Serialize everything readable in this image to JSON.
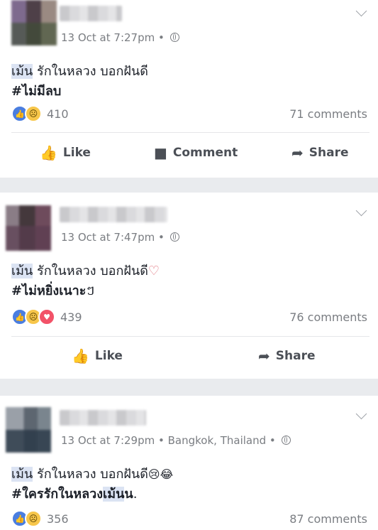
{
  "posts": [
    {
      "timestamp": "13 Oct at 7:27pm",
      "separator": "•",
      "line1_highlight": "เม้น",
      "line1_rest": " รักในหลวง บอกฝันดี",
      "line1_emoji": "",
      "line2_tag": "#ไม่มีลบ",
      "line2_highlight": "",
      "line2_tail": "",
      "reaction_count": "410",
      "comments": "71 comments",
      "actions": {
        "like": "Like",
        "comment": "Comment",
        "share": "Share"
      }
    },
    {
      "timestamp": "13 Oct at 7:47pm",
      "separator": "•",
      "line1_highlight": "เม้น",
      "line1_rest": " รักในหลวง บอกฝันดี",
      "line1_emoji": "♡",
      "line2_tag": "#ไม่หยิ่งเนาะ",
      "line2_tail": "ៗ",
      "reaction_count": "439",
      "comments": "76 comments",
      "actions": {
        "like": "Like",
        "share": "Share"
      }
    },
    {
      "timestamp": "13 Oct at 7:29pm",
      "location": "Bangkok, Thailand",
      "separator": "•",
      "line1_highlight": "เม้น",
      "line1_rest": " รักในหลวง บอกฝันดี",
      "line1_emoji": "😢😂",
      "line2_tag": "#ใครรักในหลวง",
      "line2_highlight": "เม้น",
      "line2_tag_end": "น",
      "line2_tail": ".",
      "reaction_count": "356",
      "comments": "87 comments"
    }
  ],
  "icons": [
    "chevron-down-icon",
    "globe-icon",
    "like-reaction-icon",
    "sad-reaction-icon",
    "love-reaction-icon",
    "thumbs-up-icon",
    "comment-icon",
    "share-icon"
  ],
  "colors": {
    "background": "#e9ebee",
    "card": "#ffffff",
    "highlight": "#dbe3f3",
    "like_blue": "#4a7ee0",
    "meta_gray": "#7a7d82"
  }
}
